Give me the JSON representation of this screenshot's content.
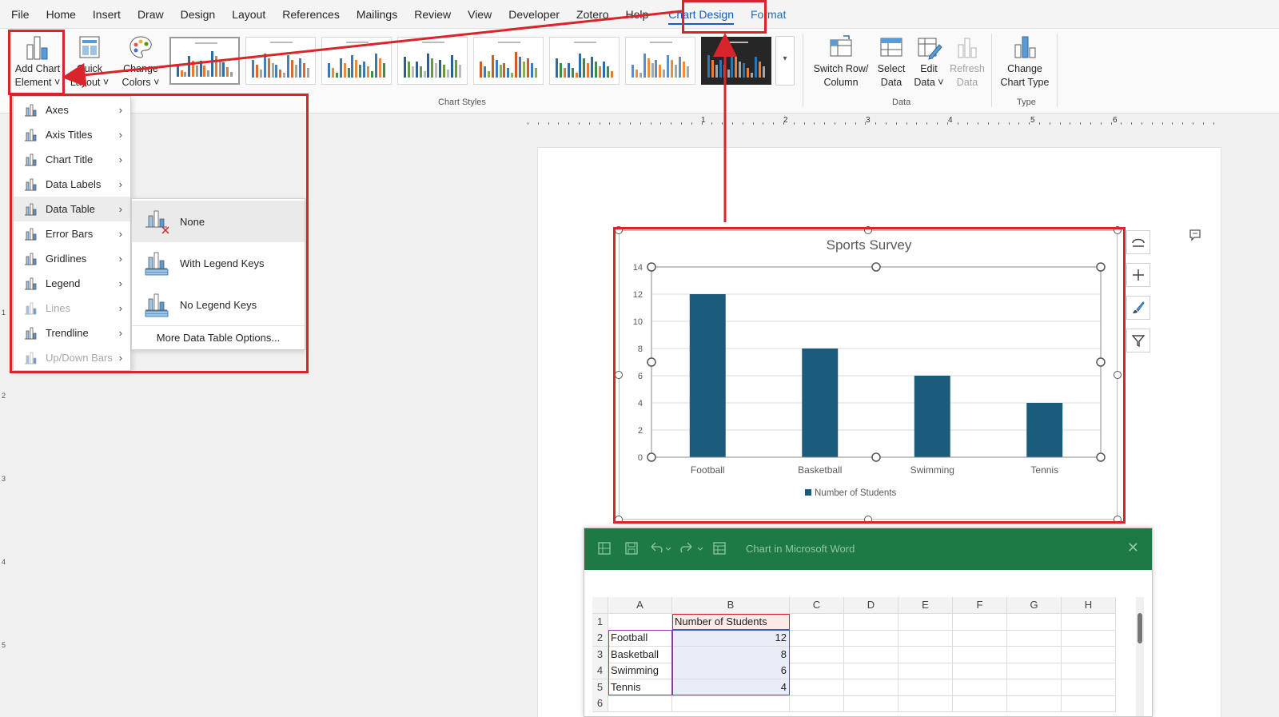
{
  "menubar": {
    "tabs": [
      "File",
      "Home",
      "Insert",
      "Draw",
      "Design",
      "Layout",
      "References",
      "Mailings",
      "Review",
      "View",
      "Developer",
      "Zotero",
      "Help"
    ],
    "chart_design": "Chart Design",
    "format": "Format"
  },
  "ribbon": {
    "add_chart_element": [
      "Add Chart",
      "Element"
    ],
    "quick_layout": [
      "Quick",
      "Layout"
    ],
    "change_colors": [
      "Change",
      "Colors"
    ],
    "chart_styles_label": "Chart Styles",
    "switch_row_column": [
      "Switch Row/",
      "Column"
    ],
    "select_data": [
      "Select",
      "Data"
    ],
    "edit_data": [
      "Edit",
      "Data"
    ],
    "refresh_data": [
      "Refresh",
      "Data"
    ],
    "data_label": "Data",
    "change_chart_type": [
      "Change",
      "Chart Type"
    ],
    "type_label": "Type"
  },
  "ruler": {
    "numbers": [
      "1",
      "2",
      "3",
      "4",
      "5",
      "6"
    ],
    "vertical_numbers": [
      "1",
      "2",
      "3",
      "4",
      "5"
    ]
  },
  "menu": {
    "items": [
      {
        "label": "Axes",
        "icon": "axes-icon",
        "disabled": false
      },
      {
        "label": "Axis Titles",
        "icon": "axis-titles-icon",
        "disabled": false
      },
      {
        "label": "Chart Title",
        "icon": "chart-title-icon",
        "disabled": false
      },
      {
        "label": "Data Labels",
        "icon": "data-labels-icon",
        "disabled": false
      },
      {
        "label": "Data Table",
        "icon": "data-table-icon",
        "disabled": false
      },
      {
        "label": "Error Bars",
        "icon": "error-bars-icon",
        "disabled": false
      },
      {
        "label": "Gridlines",
        "icon": "gridlines-icon",
        "disabled": false
      },
      {
        "label": "Legend",
        "icon": "legend-icon",
        "disabled": false
      },
      {
        "label": "Lines",
        "icon": "lines-icon",
        "disabled": true
      },
      {
        "label": "Trendline",
        "icon": "trendline-icon",
        "disabled": false
      },
      {
        "label": "Up/Down Bars",
        "icon": "up-down-bars-icon",
        "disabled": true
      }
    ]
  },
  "submenu": {
    "items": [
      {
        "label": "None",
        "icon": "data-table-none-icon"
      },
      {
        "label": "With Legend Keys",
        "icon": "data-table-legend-keys-icon"
      },
      {
        "label": "No Legend Keys",
        "icon": "data-table-no-legend-keys-icon"
      }
    ],
    "more": "More Data Table Options..."
  },
  "colors": {
    "bar": "#1b5c7c",
    "accent": "#185abd",
    "annotation": "#d9242b",
    "excel_green": "#1e7a44"
  },
  "chart_data": {
    "type": "bar",
    "title": "Sports Survey",
    "categories": [
      "Football",
      "Basketball",
      "Swimming",
      "Tennis"
    ],
    "series": [
      {
        "name": "Number of Students",
        "values": [
          12,
          8,
          6,
          4
        ]
      }
    ],
    "ylim": [
      0,
      14
    ],
    "yticks": [
      0,
      2,
      4,
      6,
      8,
      10,
      12,
      14
    ],
    "grid": true,
    "legend": "bottom"
  },
  "excel": {
    "title": "Chart in Microsoft Word",
    "columns": [
      "A",
      "B",
      "C",
      "D",
      "E",
      "F",
      "G",
      "H"
    ],
    "rows": [
      {
        "num": "1",
        "a": "",
        "b": "Number of Students"
      },
      {
        "num": "2",
        "a": "Football",
        "b": "12"
      },
      {
        "num": "3",
        "a": "Basketball",
        "b": "8"
      },
      {
        "num": "4",
        "a": "Swimming",
        "b": "6"
      },
      {
        "num": "5",
        "a": "Tennis",
        "b": "4"
      },
      {
        "num": "6",
        "a": "",
        "b": ""
      }
    ]
  }
}
